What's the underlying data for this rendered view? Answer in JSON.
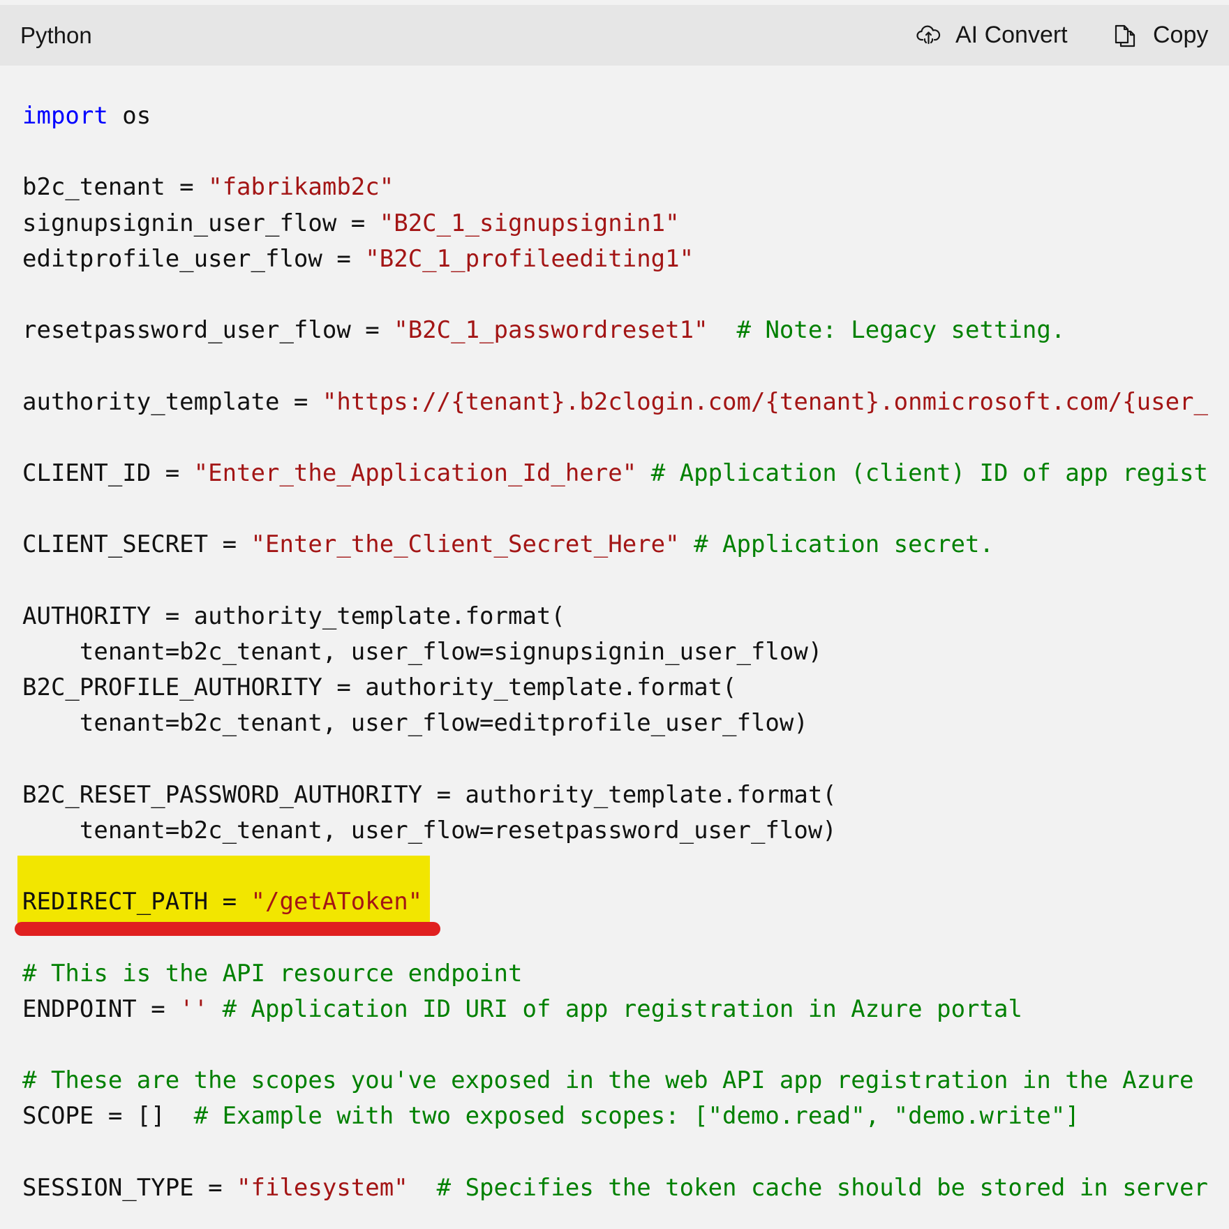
{
  "toolbar": {
    "language": "Python",
    "ai_convert_label": "AI Convert",
    "copy_label": "Copy",
    "ai_convert_icon": "cloud-sync-icon",
    "copy_icon": "copy-icon"
  },
  "colors": {
    "keyword": "#0000ff",
    "string": "#a31515",
    "comment": "#008000",
    "highlight": "#f2e600",
    "underline": "#e02020"
  },
  "code": {
    "highlighted_line_index": 22,
    "lines": [
      [
        {
          "t": "import",
          "c": "kw"
        },
        {
          "t": " os"
        }
      ],
      [],
      [
        {
          "t": "b2c_tenant = "
        },
        {
          "t": "\"fabrikamb2c\"",
          "c": "str"
        }
      ],
      [
        {
          "t": "signupsignin_user_flow = "
        },
        {
          "t": "\"B2C_1_signupsignin1\"",
          "c": "str"
        }
      ],
      [
        {
          "t": "editprofile_user_flow = "
        },
        {
          "t": "\"B2C_1_profileediting1\"",
          "c": "str"
        }
      ],
      [],
      [
        {
          "t": "resetpassword_user_flow = "
        },
        {
          "t": "\"B2C_1_passwordreset1\"",
          "c": "str"
        },
        {
          "t": "  "
        },
        {
          "t": "# Note: Legacy setting.",
          "c": "cmt"
        }
      ],
      [],
      [
        {
          "t": "authority_template = "
        },
        {
          "t": "\"https://{tenant}.b2clogin.com/{tenant}.onmicrosoft.com/{user_",
          "c": "str"
        }
      ],
      [],
      [
        {
          "t": "CLIENT_ID = "
        },
        {
          "t": "\"Enter_the_Application_Id_here\"",
          "c": "str"
        },
        {
          "t": " "
        },
        {
          "t": "# Application (client) ID of app regist",
          "c": "cmt"
        }
      ],
      [],
      [
        {
          "t": "CLIENT_SECRET = "
        },
        {
          "t": "\"Enter_the_Client_Secret_Here\"",
          "c": "str"
        },
        {
          "t": " "
        },
        {
          "t": "# Application secret.",
          "c": "cmt"
        }
      ],
      [],
      [
        {
          "t": "AUTHORITY = authority_template.format("
        }
      ],
      [
        {
          "t": "    tenant=b2c_tenant, user_flow=signupsignin_user_flow)"
        }
      ],
      [
        {
          "t": "B2C_PROFILE_AUTHORITY = authority_template.format("
        }
      ],
      [
        {
          "t": "    tenant=b2c_tenant, user_flow=editprofile_user_flow)"
        }
      ],
      [],
      [
        {
          "t": "B2C_RESET_PASSWORD_AUTHORITY = authority_template.format("
        }
      ],
      [
        {
          "t": "    tenant=b2c_tenant, user_flow=resetpassword_user_flow)"
        }
      ],
      [],
      [
        {
          "t": "REDIRECT_PATH = "
        },
        {
          "t": "\"/getAToken\"",
          "c": "str"
        }
      ],
      [],
      [
        {
          "t": "# This is the API resource endpoint",
          "c": "cmt"
        }
      ],
      [
        {
          "t": "ENDPOINT = "
        },
        {
          "t": "''",
          "c": "str"
        },
        {
          "t": " "
        },
        {
          "t": "# Application ID URI of app registration in Azure portal",
          "c": "cmt"
        }
      ],
      [],
      [
        {
          "t": "# These are the scopes you've exposed in the web API app registration in the Azure",
          "c": "cmt"
        }
      ],
      [
        {
          "t": "SCOPE = []  "
        },
        {
          "t": "# Example with two exposed scopes: [\"demo.read\", \"demo.write\"]",
          "c": "cmt"
        }
      ],
      [],
      [
        {
          "t": "SESSION_TYPE = "
        },
        {
          "t": "\"filesystem\"",
          "c": "str"
        },
        {
          "t": "  "
        },
        {
          "t": "# Specifies the token cache should be stored in server",
          "c": "cmt"
        }
      ]
    ]
  }
}
